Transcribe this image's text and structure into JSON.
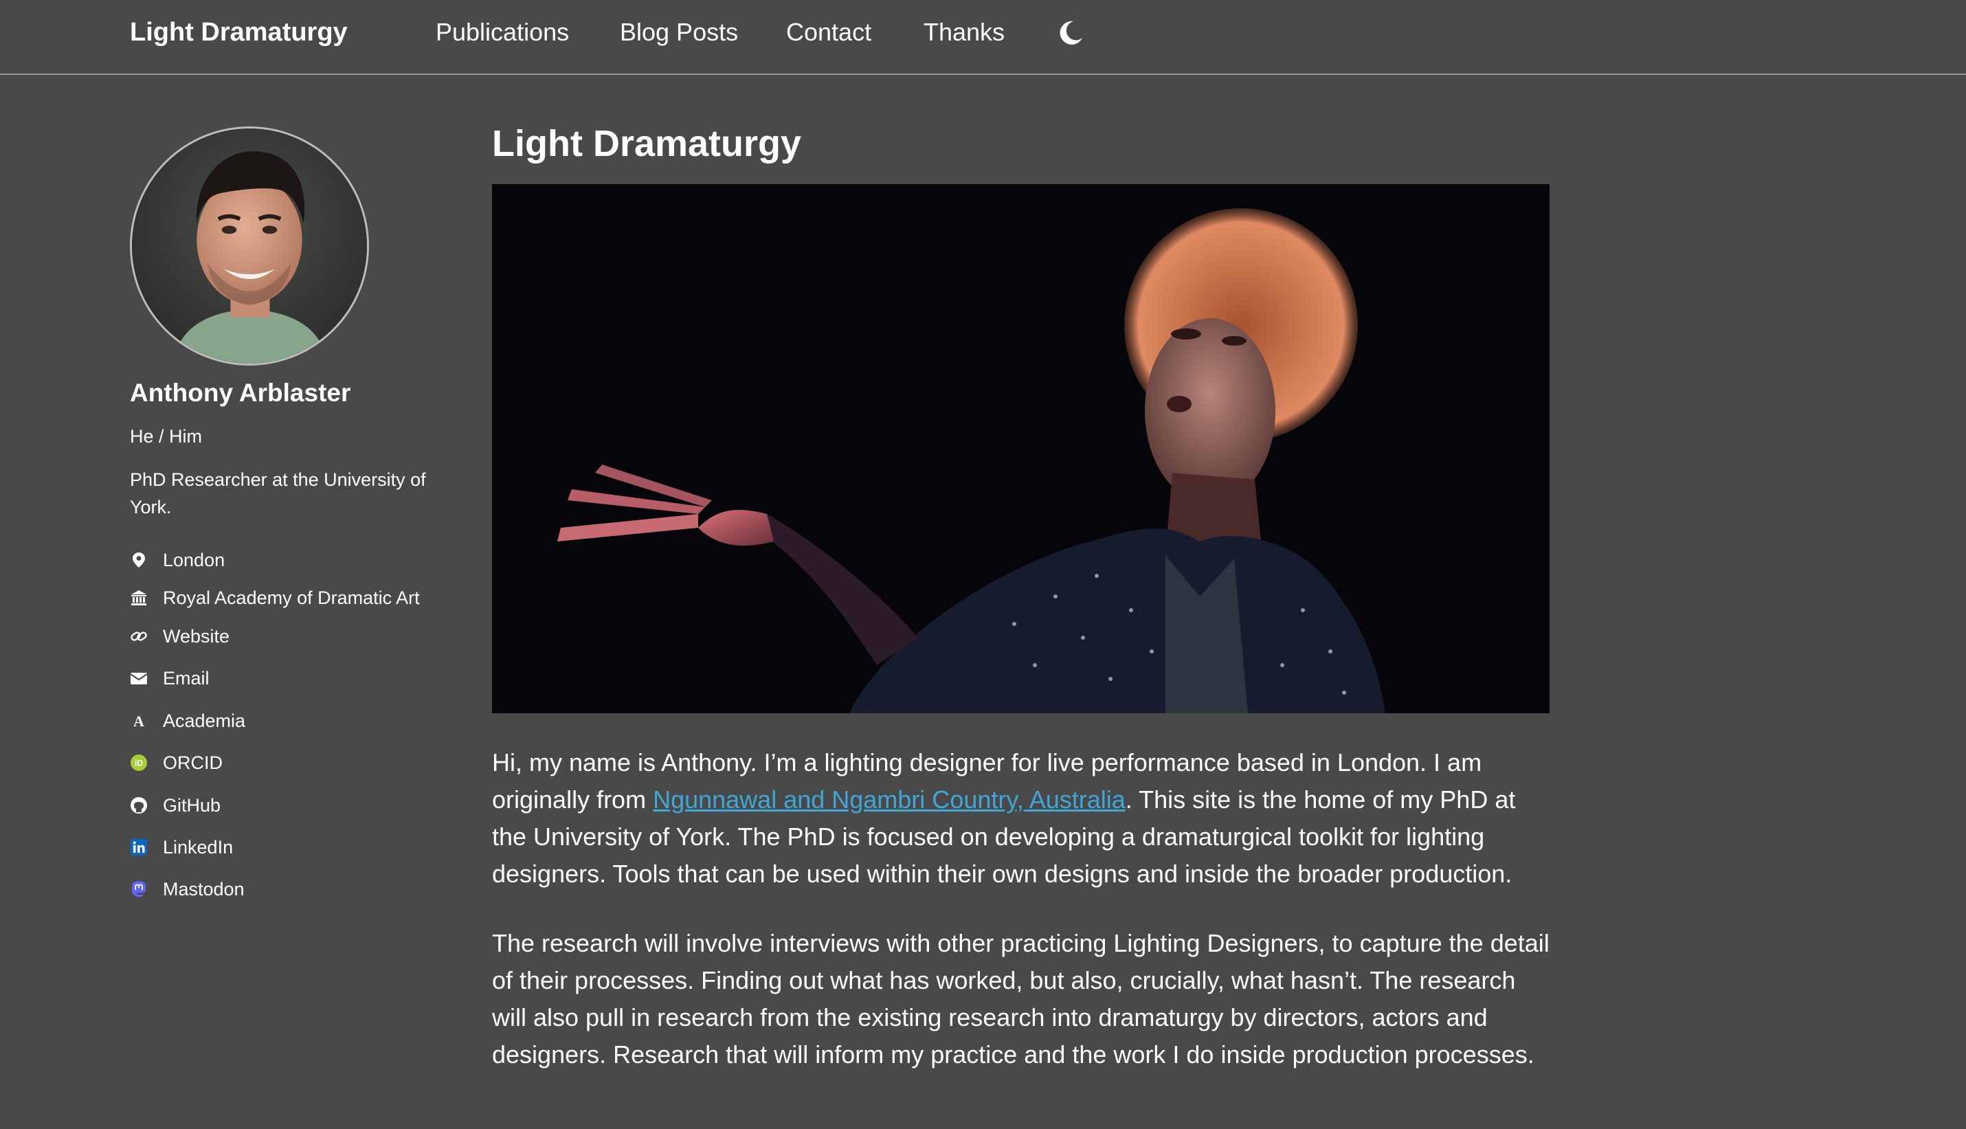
{
  "header": {
    "brand": "Light Dramaturgy",
    "nav": [
      "Publications",
      "Blog Posts",
      "Contact",
      "Thanks"
    ],
    "theme_toggle_icon": "moon-icon"
  },
  "sidebar": {
    "name": "Anthony Arblaster",
    "pronouns": "He / Him",
    "bio": "PhD Researcher at the University of York.",
    "links": [
      {
        "label": "London",
        "icon": "location-pin-icon"
      },
      {
        "label": "Royal Academy of Dramatic Art",
        "icon": "institution-icon"
      },
      {
        "label": "Website",
        "icon": "link-icon"
      },
      {
        "label": "Email",
        "icon": "envelope-icon"
      },
      {
        "label": "Academia",
        "icon": "academia-icon"
      },
      {
        "label": "ORCID",
        "icon": "orcid-icon"
      },
      {
        "label": "GitHub",
        "icon": "github-icon"
      },
      {
        "label": "LinkedIn",
        "icon": "linkedin-icon"
      },
      {
        "label": "Mastodon",
        "icon": "mastodon-icon"
      }
    ]
  },
  "main": {
    "title": "Light Dramaturgy",
    "intro_before_link": "Hi, my name is Anthony. I’m a lighting designer for live performance based in London. I am originally from ",
    "intro_link": "Ngunnawal and Ngambri Country, Australia",
    "intro_after_link": ". This site is the home of my PhD at the University of York. The PhD is focused on developing a dramaturgical toolkit for lighting designers. Tools that can be used within their own designs and inside the broader production.",
    "paragraph2": "The research will involve interviews with other practicing Lighting Designers, to capture the detail of their processes. Finding out what has worked, but also, crucially, what hasn’t. The research will also pull in research from the existing research into dramaturgy by directors, actors and designers. Research that will inform my practice and the work I do inside production processes."
  },
  "colors": {
    "background": "#494949",
    "link": "#3fa7d6",
    "orcid": "#a6ce39",
    "linkedin": "#0a66c2",
    "mastodon": "#6364ff"
  }
}
